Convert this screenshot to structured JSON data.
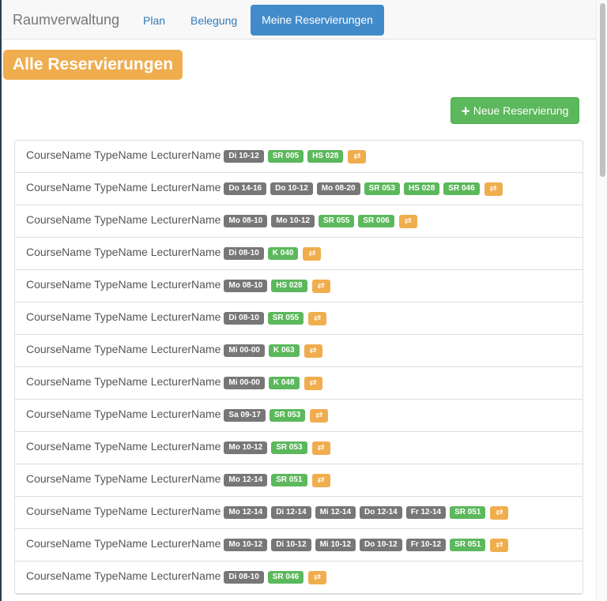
{
  "navbar": {
    "brand": "Raumverwaltung",
    "links": [
      {
        "label": "Plan"
      },
      {
        "label": "Belegung"
      }
    ],
    "active_link": "Meine Reservierungen"
  },
  "page": {
    "title": "Alle Reservierungen",
    "new_button_label": "Neue Reservierung"
  },
  "colors": {
    "time_label": "#777777",
    "room_label": "#5cb85c",
    "swap_button": "#f0ad4e",
    "active_nav": "#428bca",
    "title_badge": "#f0ad4e"
  },
  "icons": {
    "new_button": "plus-icon",
    "swap_button": "swap-icon"
  },
  "reservations": [
    {
      "text": "CourseName TypeName LecturerName",
      "times": [
        "Di 10-12"
      ],
      "rooms": [
        "SR 005",
        "HS 028"
      ]
    },
    {
      "text": "CourseName TypeName LecturerName",
      "times": [
        "Do 14-16",
        "Do 10-12",
        "Mo 08-20"
      ],
      "rooms": [
        "SR 053",
        "HS 028",
        "SR 046"
      ]
    },
    {
      "text": "CourseName TypeName LecturerName",
      "times": [
        "Mo 08-10",
        "Mo 10-12"
      ],
      "rooms": [
        "SR 055",
        "SR 006"
      ]
    },
    {
      "text": "CourseName TypeName LecturerName",
      "times": [
        "Di 08-10"
      ],
      "rooms": [
        "K 040"
      ]
    },
    {
      "text": "CourseName TypeName LecturerName",
      "times": [
        "Mo 08-10"
      ],
      "rooms": [
        "HS 028"
      ]
    },
    {
      "text": "CourseName TypeName LecturerName",
      "times": [
        "Di 08-10"
      ],
      "rooms": [
        "SR 055"
      ]
    },
    {
      "text": "CourseName TypeName LecturerName",
      "times": [
        "Mi 00-00"
      ],
      "rooms": [
        "K 063"
      ]
    },
    {
      "text": "CourseName TypeName LecturerName",
      "times": [
        "Mi 00-00"
      ],
      "rooms": [
        "K 048"
      ]
    },
    {
      "text": "CourseName TypeName LecturerName",
      "times": [
        "Sa 09-17"
      ],
      "rooms": [
        "SR 053"
      ]
    },
    {
      "text": "CourseName TypeName LecturerName",
      "times": [
        "Mo 10-12"
      ],
      "rooms": [
        "SR 053"
      ]
    },
    {
      "text": "CourseName TypeName LecturerName",
      "times": [
        "Mo 12-14"
      ],
      "rooms": [
        "SR 051"
      ]
    },
    {
      "text": "CourseName TypeName LecturerName",
      "times": [
        "Mo 12-14",
        "Di 12-14",
        "Mi 12-14",
        "Do 12-14",
        "Fr 12-14"
      ],
      "rooms": [
        "SR 051"
      ]
    },
    {
      "text": "CourseName TypeName LecturerName",
      "times": [
        "Mo 10-12",
        "Di 10-12",
        "Mi 10-12",
        "Do 10-12",
        "Fr 10-12"
      ],
      "rooms": [
        "SR 051"
      ]
    },
    {
      "text": "CourseName TypeName LecturerName",
      "times": [
        "Di 08-10"
      ],
      "rooms": [
        "SR 046"
      ]
    }
  ]
}
